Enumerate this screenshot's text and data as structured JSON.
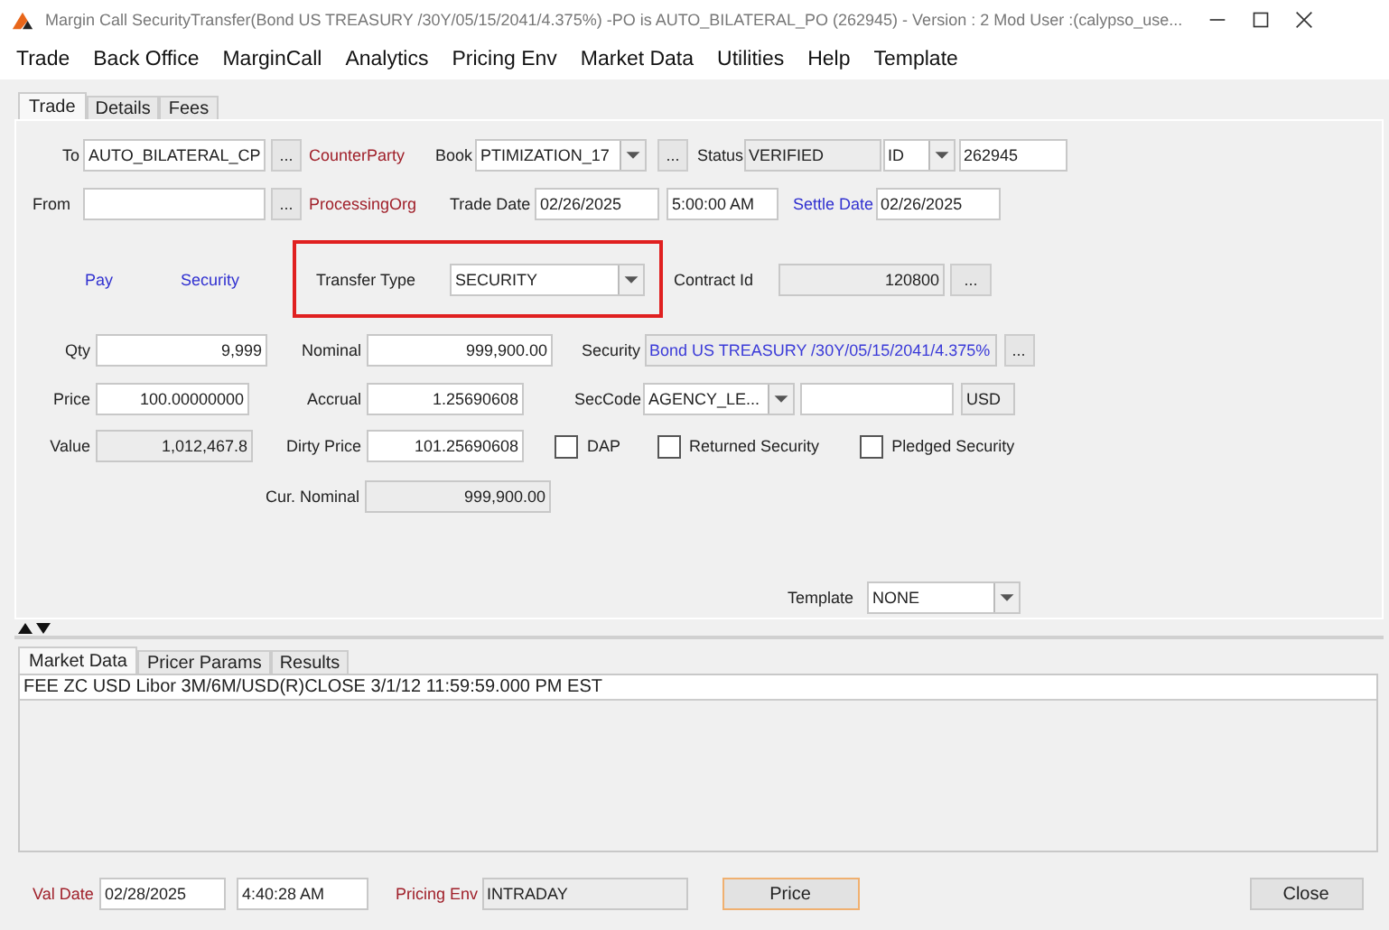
{
  "window": {
    "title": "Margin Call SecurityTransfer(Bond US TREASURY /30Y/05/15/2041/4.375%)  -PO is AUTO_BILATERAL_PO  (262945) - Version : 2 Mod User :(calypso_use..."
  },
  "menu": [
    "Trade",
    "Back Office",
    "MarginCall",
    "Analytics",
    "Pricing Env",
    "Market Data",
    "Utilities",
    "Help",
    "Template"
  ],
  "tabs": [
    {
      "label": "Trade",
      "selected": true
    },
    {
      "label": "Details",
      "selected": false
    },
    {
      "label": "Fees",
      "selected": false
    }
  ],
  "to": {
    "label": "To",
    "value": "AUTO_BILATERAL_CP",
    "editable": true,
    "button": "...",
    "role": "CounterParty"
  },
  "book": {
    "label": "Book",
    "value": "PTIMIZATION_17",
    "button": "..."
  },
  "status": {
    "label": "Status",
    "value": "VERIFIED",
    "editable": false
  },
  "id_type": {
    "value": "ID"
  },
  "trade_id": {
    "value": "262945",
    "editable": true
  },
  "from": {
    "label": "From",
    "editable": true,
    "button": "...",
    "role": "ProcessingOrg"
  },
  "trade_date": {
    "label": "Trade Date",
    "value": "02/26/2025",
    "editable": true
  },
  "trade_time": {
    "value": "5:00:00 AM",
    "editable": true
  },
  "settle_date": {
    "label": "Settle Date",
    "value": "02/26/2025",
    "editable": true
  },
  "direction": {
    "pay": "Pay",
    "type": "Security"
  },
  "transfer_type": {
    "label": "Transfer Type",
    "value": "SECURITY",
    "highlighted": true
  },
  "contract_id": {
    "label": "Contract Id",
    "value": "120800",
    "editable": false,
    "button": "..."
  },
  "qty": {
    "label": "Qty",
    "value": "9,999",
    "editable": true
  },
  "nominal": {
    "label": "Nominal",
    "value": "999,900.00",
    "editable": true
  },
  "security": {
    "label": "Security",
    "value": "Bond US TREASURY /30Y/05/15/2041/4.375%",
    "editable": false,
    "button": "..."
  },
  "price": {
    "label": "Price",
    "value": "100.00000000",
    "editable": true
  },
  "accrual": {
    "label": "Accrual",
    "value": "1.25690608",
    "editable": true
  },
  "sec_code": {
    "label": "SecCode",
    "value": "AGENCY_LE..."
  },
  "sec_code_value": {
    "editable": true
  },
  "currency": {
    "value": "USD",
    "editable": false
  },
  "value": {
    "label": "Value",
    "value": "1,012,467.8",
    "editable": false
  },
  "dirty_price": {
    "label": "Dirty Price",
    "value": "101.25690608",
    "editable": true
  },
  "checkboxes": [
    {
      "label": "DAP",
      "checked": false
    },
    {
      "label": "Returned Security",
      "checked": false
    },
    {
      "label": "Pledged Security",
      "checked": false
    }
  ],
  "cur_nominal": {
    "label": "Cur. Nominal",
    "value": "999,900.00",
    "editable": false
  },
  "template": {
    "label": "Template",
    "value": "NONE"
  },
  "bottom_tabs": [
    {
      "label": "Market Data",
      "selected": true
    },
    {
      "label": "Pricer Params",
      "selected": false
    },
    {
      "label": "Results",
      "selected": false
    }
  ],
  "market_data": [
    {
      "text": "FEE   ZC USD Libor 3M/6M/USD(R)CLOSE 3/1/12 11:59:59.000 PM EST"
    }
  ],
  "val_date": {
    "label": "Val Date",
    "value": "02/28/2025",
    "editable": true
  },
  "val_time": {
    "value": "4:40:28 AM",
    "editable": true
  },
  "pricing_env": {
    "label": "Pricing Env",
    "value": "INTRADAY",
    "editable": false
  },
  "buttons": [
    {
      "label": "Price",
      "focused": true
    },
    {
      "label": "Close",
      "focused": false
    }
  ]
}
